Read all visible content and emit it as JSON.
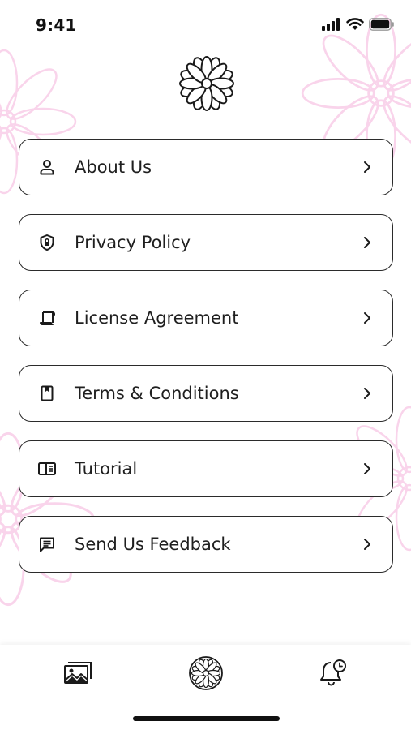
{
  "status_bar": {
    "time": "9:41",
    "icons": [
      "cellular-signal-icon",
      "wifi-icon",
      "battery-icon"
    ]
  },
  "header": {
    "logo_icon": "flower-logo-icon"
  },
  "menu": {
    "items": [
      {
        "label": "About Us",
        "icon": "person-icon"
      },
      {
        "label": "Privacy Policy",
        "icon": "shield-lock-icon"
      },
      {
        "label": "License Agreement",
        "icon": "scroll-icon"
      },
      {
        "label": "Terms & Conditions",
        "icon": "bookmark-page-icon"
      },
      {
        "label": "Tutorial",
        "icon": "book-icon"
      },
      {
        "label": "Send Us Feedback",
        "icon": "message-icon"
      }
    ]
  },
  "tab_bar": {
    "tabs": [
      {
        "icon": "gallery-icon"
      },
      {
        "icon": "mandala-icon"
      },
      {
        "icon": "bell-clock-icon"
      }
    ]
  },
  "colors": {
    "accent_pink": "#f7c6e4",
    "border": "#2b2b2b",
    "text": "#1f1f1f"
  }
}
